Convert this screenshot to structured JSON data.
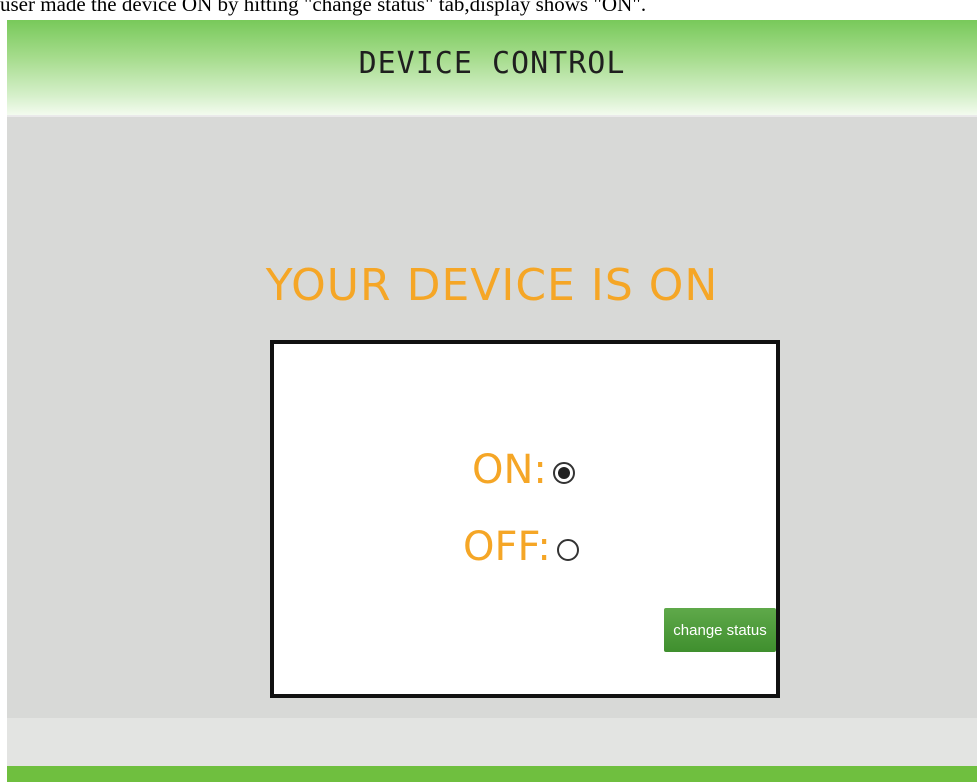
{
  "caption": "user made the device ON by hitting \"change status\" tab,display shows \"ON\".",
  "header": {
    "title": "DEVICE CONTROL"
  },
  "status": {
    "heading": "YOUR DEVICE IS ON"
  },
  "control": {
    "options": [
      {
        "label": "ON:",
        "checked": true
      },
      {
        "label": "OFF:",
        "checked": false
      }
    ],
    "button_label": "change status"
  },
  "colors": {
    "header_green": "#78c95a",
    "accent_orange": "#f5a626",
    "button_green": "#4e9c3b",
    "background_gray": "#d8d9d7",
    "footer_green": "#6fbf3f"
  }
}
